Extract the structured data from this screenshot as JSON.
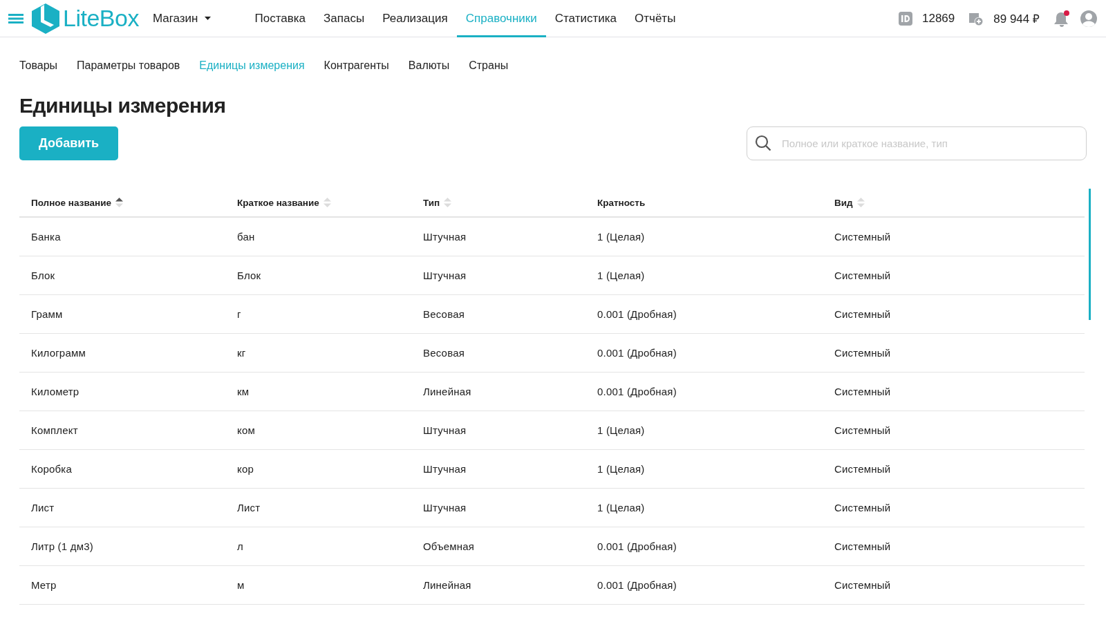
{
  "header": {
    "logo": "LiteBox",
    "store": "Магазин",
    "nav": [
      {
        "label": "Поставка",
        "selected": false
      },
      {
        "label": "Запасы",
        "selected": false
      },
      {
        "label": "Реализация",
        "selected": false
      },
      {
        "label": "Справочники",
        "selected": true
      },
      {
        "label": "Статистика",
        "selected": false
      },
      {
        "label": "Отчёты",
        "selected": false
      }
    ],
    "account_id": "12869",
    "balance": "89 944 ₽",
    "has_notifications": true
  },
  "subnav": [
    {
      "label": "Товары",
      "selected": false
    },
    {
      "label": "Параметры товаров",
      "selected": false
    },
    {
      "label": "Единицы измерения",
      "selected": true
    },
    {
      "label": "Контрагенты",
      "selected": false
    },
    {
      "label": "Валюты",
      "selected": false
    },
    {
      "label": "Страны",
      "selected": false
    }
  ],
  "title": "Единицы измерения",
  "add_button": "Добавить",
  "search": {
    "placeholder": "Полное или краткое название, тип"
  },
  "table": {
    "columns": [
      {
        "label": "Полное название",
        "sortable": true,
        "sorted": true
      },
      {
        "label": "Краткое название",
        "sortable": true,
        "sorted": false
      },
      {
        "label": "Тип",
        "sortable": true,
        "sorted": false
      },
      {
        "label": "Кратность",
        "sortable": false
      },
      {
        "label": "Вид",
        "sortable": true,
        "sorted": false
      }
    ],
    "rows": [
      [
        "Банка",
        "бан",
        "Штучная",
        "1 (Целая)",
        "Системный"
      ],
      [
        "Блок",
        "Блок",
        "Штучная",
        "1 (Целая)",
        "Системный"
      ],
      [
        "Грамм",
        "г",
        "Весовая",
        "0.001 (Дробная)",
        "Системный"
      ],
      [
        "Килограмм",
        "кг",
        "Весовая",
        "0.001 (Дробная)",
        "Системный"
      ],
      [
        "Километр",
        "км",
        "Линейная",
        "0.001 (Дробная)",
        "Системный"
      ],
      [
        "Комплект",
        "ком",
        "Штучная",
        "1 (Целая)",
        "Системный"
      ],
      [
        "Коробка",
        "кор",
        "Штучная",
        "1 (Целая)",
        "Системный"
      ],
      [
        "Лист",
        "Лист",
        "Штучная",
        "1 (Целая)",
        "Системный"
      ],
      [
        "Литр (1 дм3)",
        "л",
        "Объемная",
        "0.001 (Дробная)",
        "Системный"
      ],
      [
        "Метр",
        "м",
        "Линейная",
        "0.001 (Дробная)",
        "Системный"
      ]
    ]
  }
}
